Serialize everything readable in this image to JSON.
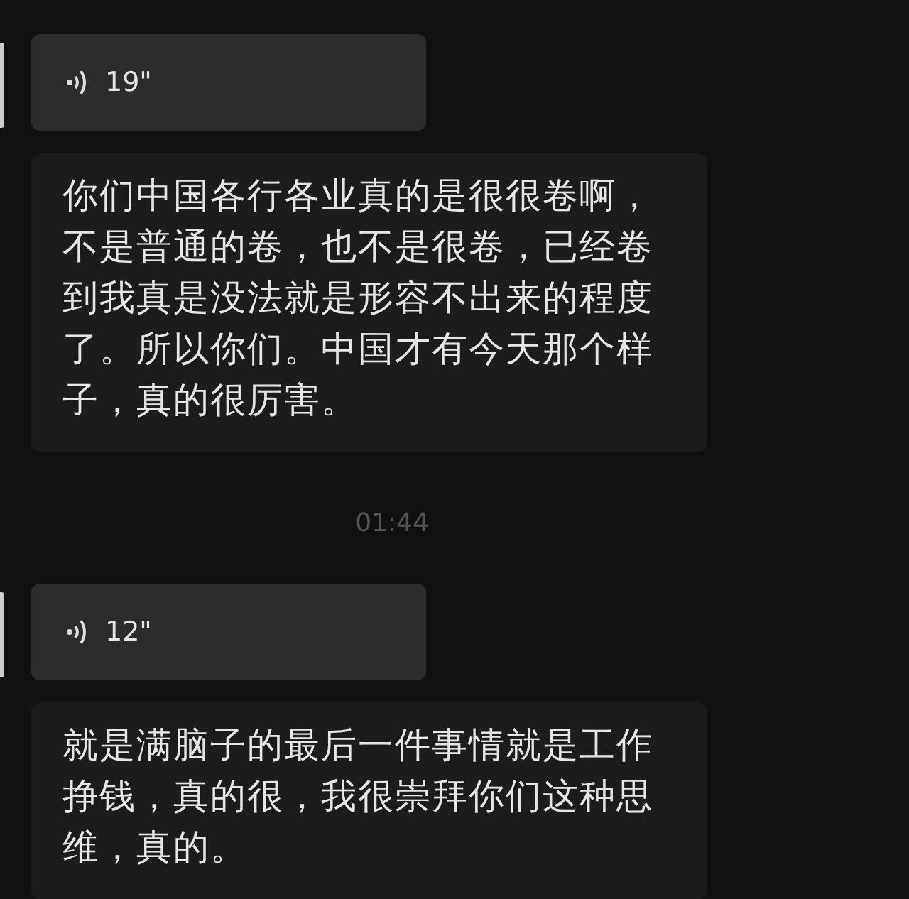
{
  "messages": [
    {
      "kind": "voice",
      "duration": "19\""
    },
    {
      "kind": "text",
      "text": "你们中国各行各业真的是很很卷啊，不是普通的卷，也不是很卷，已经卷到我真是没法就是形容不出来的程度了。所以你们。中国才有今天那个样子，真的很厉害。"
    },
    {
      "kind": "time",
      "text": "01:44"
    },
    {
      "kind": "voice",
      "duration": "12\""
    },
    {
      "kind": "text",
      "text": "就是满脑子的最后一件事情就是工作挣钱，真的很，我很崇拜你们这种思维，真的。"
    }
  ]
}
